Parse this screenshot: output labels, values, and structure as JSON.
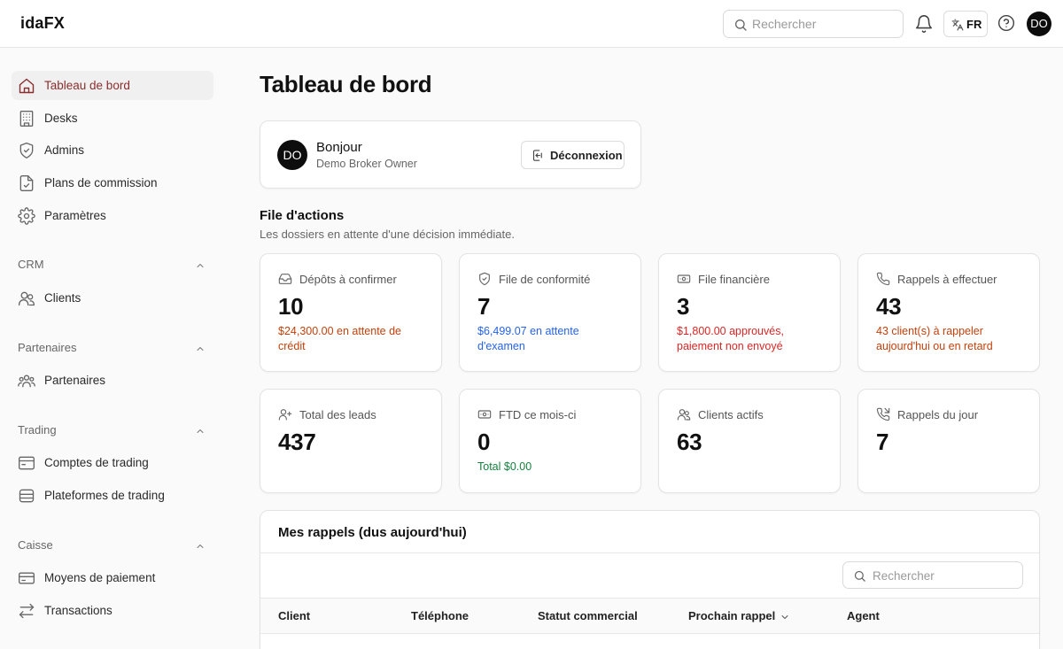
{
  "app": {
    "brand": "idaFX"
  },
  "topbar": {
    "search_placeholder": "Rechercher",
    "lang_code": "FR",
    "avatar_initials": "DO"
  },
  "sidebar": {
    "main_items": [
      {
        "label": "Tableau de bord",
        "icon": "home-icon",
        "active": true
      },
      {
        "label": "Desks",
        "icon": "building-icon"
      },
      {
        "label": "Admins",
        "icon": "shield-icon"
      },
      {
        "label": "Plans de commission",
        "icon": "document-icon"
      },
      {
        "label": "Paramètres",
        "icon": "gear-icon"
      }
    ],
    "sections": [
      {
        "title": "CRM",
        "items": [
          {
            "label": "Clients",
            "icon": "users-icon"
          }
        ]
      },
      {
        "title": "Partenaires",
        "items": [
          {
            "label": "Partenaires",
            "icon": "group-icon"
          }
        ]
      },
      {
        "title": "Trading",
        "items": [
          {
            "label": "Comptes de trading",
            "icon": "wallet-icon"
          },
          {
            "label": "Plateformes de trading",
            "icon": "database-icon"
          }
        ]
      },
      {
        "title": "Caisse",
        "items": [
          {
            "label": "Moyens de paiement",
            "icon": "credit-card-icon"
          },
          {
            "label": "Transactions",
            "icon": "arrows-icon"
          }
        ]
      }
    ]
  },
  "main": {
    "title": "Tableau de bord",
    "greeting": {
      "avatar": "DO",
      "hello": "Bonjour",
      "role": "Demo Broker Owner",
      "logout_label": "Déconnexion"
    },
    "actions": {
      "title": "File d'actions",
      "subtitle": "Les dossiers en attente d'une décision immédiate.",
      "cards": [
        {
          "label": "Dépôts à confirmer",
          "value": "10",
          "note": "$24,300.00 en attente de crédit",
          "note_color": "#c2410c",
          "icon": "inbox-icon"
        },
        {
          "label": "File de conformité",
          "value": "7",
          "note": "$6,499.07 en attente d'examen",
          "note_color": "#2563eb",
          "icon": "shield-check-icon"
        },
        {
          "label": "File financière",
          "value": "3",
          "note": "$1,800.00 approuvés, paiement non envoyé",
          "note_color": "#dc2626",
          "icon": "banknote-icon"
        },
        {
          "label": "Rappels à effectuer",
          "value": "43",
          "note": "43 client(s) à rappeler aujourd'hui ou en retard",
          "note_color": "#c2410c",
          "icon": "phone-icon"
        }
      ]
    },
    "stats": [
      {
        "label": "Total des leads",
        "value": "437",
        "note": "",
        "icon": "user-plus-icon"
      },
      {
        "label": "FTD ce mois-ci",
        "value": "0",
        "note": "Total $0.00",
        "note_color": "#15803d",
        "icon": "banknote-icon"
      },
      {
        "label": "Clients actifs",
        "value": "63",
        "note": "",
        "icon": "users-icon"
      },
      {
        "label": "Rappels du jour",
        "value": "7",
        "note": "",
        "icon": "phone-call-icon"
      }
    ],
    "calls": {
      "title": "Mes rappels (dus aujourd'hui)",
      "search_placeholder": "Rechercher",
      "columns": [
        "Client",
        "Téléphone",
        "Statut commercial",
        "Prochain rappel",
        "Agent"
      ]
    }
  }
}
